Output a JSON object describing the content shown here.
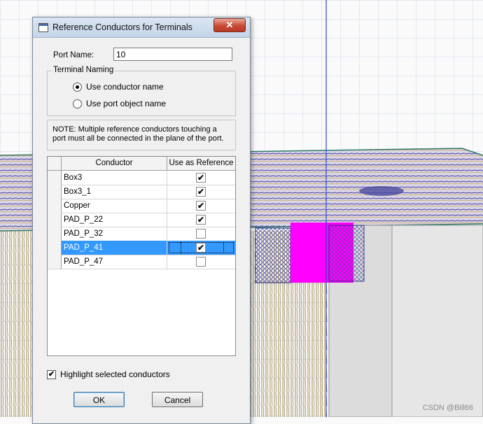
{
  "dialog": {
    "title": "Reference Conductors for Terminals",
    "close_glyph": "✕",
    "port_name_label": "Port Name:",
    "port_name_value": "10",
    "terminal_naming": {
      "label": "Terminal Naming",
      "options": [
        {
          "label": "Use conductor name",
          "selected": true
        },
        {
          "label": "Use port object name",
          "selected": false
        }
      ]
    },
    "note": "NOTE: Multiple reference conductors touching a port must all be connected in the plane of the port.",
    "table": {
      "headers": [
        "Conductor",
        "Use as Reference"
      ],
      "rows": [
        {
          "name": "Box3",
          "checked": true,
          "selected": false
        },
        {
          "name": "Box3_1",
          "checked": true,
          "selected": false
        },
        {
          "name": "Copper",
          "checked": true,
          "selected": false
        },
        {
          "name": "PAD_P_22",
          "checked": true,
          "selected": false
        },
        {
          "name": "PAD_P_32",
          "checked": false,
          "selected": false
        },
        {
          "name": "PAD_P_41",
          "checked": true,
          "selected": true
        },
        {
          "name": "PAD_P_47",
          "checked": false,
          "selected": false
        }
      ]
    },
    "highlight_label": "Highlight selected conductors",
    "highlight_checked": true,
    "ok_label": "OK",
    "cancel_label": "Cancel"
  },
  "watermark": "CSDN @Bill66",
  "colors": {
    "selection": "#3399ff",
    "highlight_port": "#ff00ff",
    "grid_lines": "#c8d4e6"
  }
}
